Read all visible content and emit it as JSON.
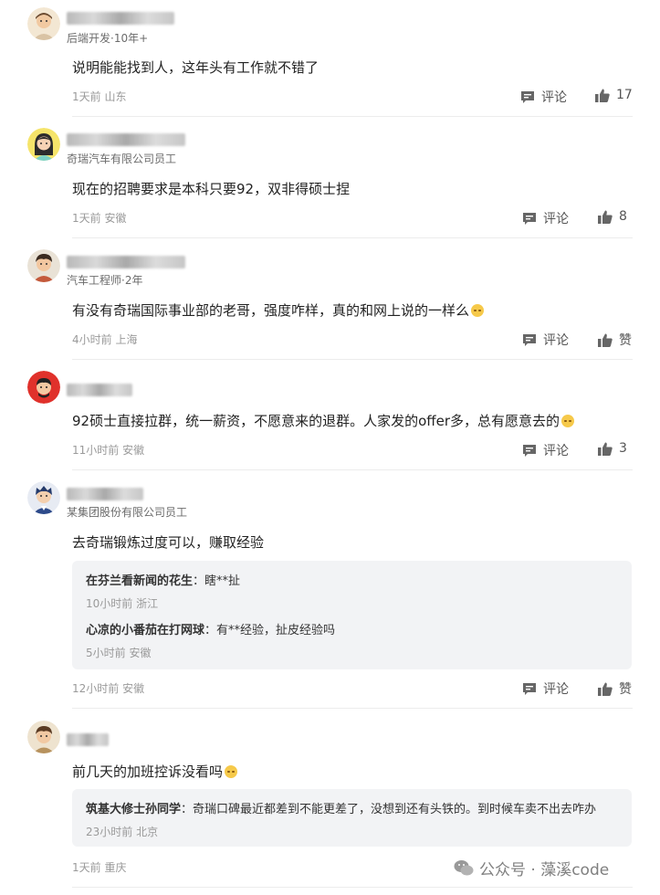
{
  "labels": {
    "comment": "评论",
    "like": "赞"
  },
  "comments": [
    {
      "meta": "后端开发·10年+",
      "content": "说明能能找到人，这年头有工作就不错了",
      "info": "1天前 山东",
      "likes": "17"
    },
    {
      "meta": "奇瑞汽车有限公司员工",
      "content": "现在的招聘要求是本科只要92，双非得硕士捏",
      "info": "1天前 安徽",
      "likes": "8"
    },
    {
      "meta": "汽车工程师·2年",
      "content": "有没有奇瑞国际事业部的老哥，强度咋样，真的和网上说的一样么",
      "info": "4小时前 上海",
      "likes": "赞"
    },
    {
      "meta": "",
      "content": "92硕士直接拉群，统一薪资，不愿意来的退群。人家发的offer多，总有愿意去的",
      "info": "11小时前 安徽",
      "likes": "3"
    },
    {
      "meta": "某集团股份有限公司员工",
      "content": "去奇瑞锻炼过度可以，赚取经验",
      "info": "12小时前 安徽",
      "likes": "赞",
      "replies": [
        {
          "name": "在芬兰看新闻的花生",
          "text": "瞎**扯",
          "info": "10小时前 浙江"
        },
        {
          "name": "心凉的小番茄在打网球",
          "text": "有**经验，扯皮经验吗",
          "info": "5小时前 安徽"
        }
      ]
    },
    {
      "meta": "",
      "content": "前几天的加班控诉没看吗",
      "info": "1天前 重庆",
      "likes": "3",
      "replies": [
        {
          "name": "筑基大修士孙同学",
          "text": "奇瑞口碑最近都差到不能更差了，没想到还有头铁的。到时候车卖不出去咋办",
          "info": "23小时前 北京"
        }
      ]
    }
  ],
  "watermark": {
    "text": "公众号 · 藻溪code"
  },
  "colors": {
    "text": "#222222",
    "muted": "#9a9a9a",
    "reply_bg": "#f2f3f5",
    "divider": "#ececec"
  }
}
